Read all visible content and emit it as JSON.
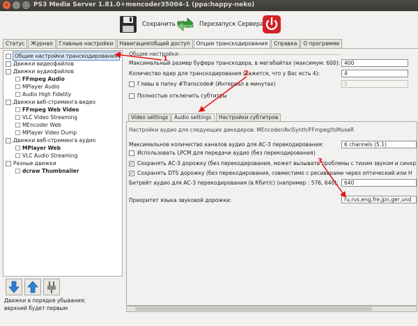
{
  "window": {
    "title": "PS3 Media Server 1.81.0+mencoder35004-1 (ppa:happy-neko)"
  },
  "toolbar": {
    "save_label": "Сохранить",
    "restart_label": "Перезапуск Сервера"
  },
  "tabs": [
    {
      "label": "Статус"
    },
    {
      "label": "Журнал"
    },
    {
      "label": "Главные настройки"
    },
    {
      "label": "Навигация/общий доступ"
    },
    {
      "label": "Опции транскодирования"
    },
    {
      "label": "Справка"
    },
    {
      "label": "О программе"
    }
  ],
  "tree": {
    "items": [
      {
        "label": "Общие настройки транскодирования"
      },
      {
        "label": "Движки видеофайлов"
      },
      {
        "label": "Движки аудиофайлов"
      },
      {
        "label": "FFmpeg Audio"
      },
      {
        "label": "MPlayer Audio"
      },
      {
        "label": "Audio High Fidelity"
      },
      {
        "label": "Движки веб-стриминга видео"
      },
      {
        "label": "FFmpeg Web Video"
      },
      {
        "label": "VLC Video Streaming"
      },
      {
        "label": "MEncoder Web"
      },
      {
        "label": "MPlayer Video Dump"
      },
      {
        "label": "Движки веб-стриминга аудио"
      },
      {
        "label": "MPlayer Web"
      },
      {
        "label": "VLC Audio Streaming"
      },
      {
        "label": "Разные движки"
      },
      {
        "label": "dcraw Thumbnailer"
      }
    ],
    "hint_line1": "Движки в порядке убывания;",
    "hint_line2": "верхний будет первым"
  },
  "general": {
    "title": "Общие настройки",
    "buffer_label": "Максимальный размер буфера транскодера, в мегабайтах (максимум: 600):",
    "buffer_value": "400",
    "cores_label": "Количество ядер для транскодирования (кажется, что у Вас есть 4):",
    "cores_value": "4",
    "chapters_label": "Главы в папку #Transcode# (Интервал в минутах)",
    "chapters_value": "5",
    "disable_subs_label": "Полностью отключить субтитры"
  },
  "subtabs": [
    {
      "label": "Video settings"
    },
    {
      "label": "Audio settings"
    },
    {
      "label": "Настройки субтитров"
    }
  ],
  "audio": {
    "title": "Настройки аудио для следующих декодеров: MEncoder/AviSynth/FFmpeg/tsMuxeR",
    "channels_label": "Максимальное количество каналов аудио для AC-3 перекодирования:",
    "channels_value": "6 channels (5.1)",
    "lpcm_label": "Использовать LPCM для передачи аудио (без перекодирования)",
    "ac3_label": "Сохранять AC-3 дорожку (без перекодирования, может вызывать проблемы с тихим звуком и синхр",
    "dts_label": "Сохранять DTS дорожку (без перекодирования, совместимо с ресиверами через оптический или H",
    "bitrate_label": "Битрейт аудио для AC-3 перекодирования (в Кбит/с) (например : 576, 640):",
    "bitrate_value": "640",
    "lang_label": "Приоритет языка звуковой дорожки:",
    "lang_value": "ru,rus,eng,fre,jpn,ger,und"
  },
  "annotations": {
    "n1": "1",
    "n2": "2",
    "n3": "3"
  },
  "colors": {
    "annotation": "#e21414",
    "selection": "#dbe6f4"
  }
}
